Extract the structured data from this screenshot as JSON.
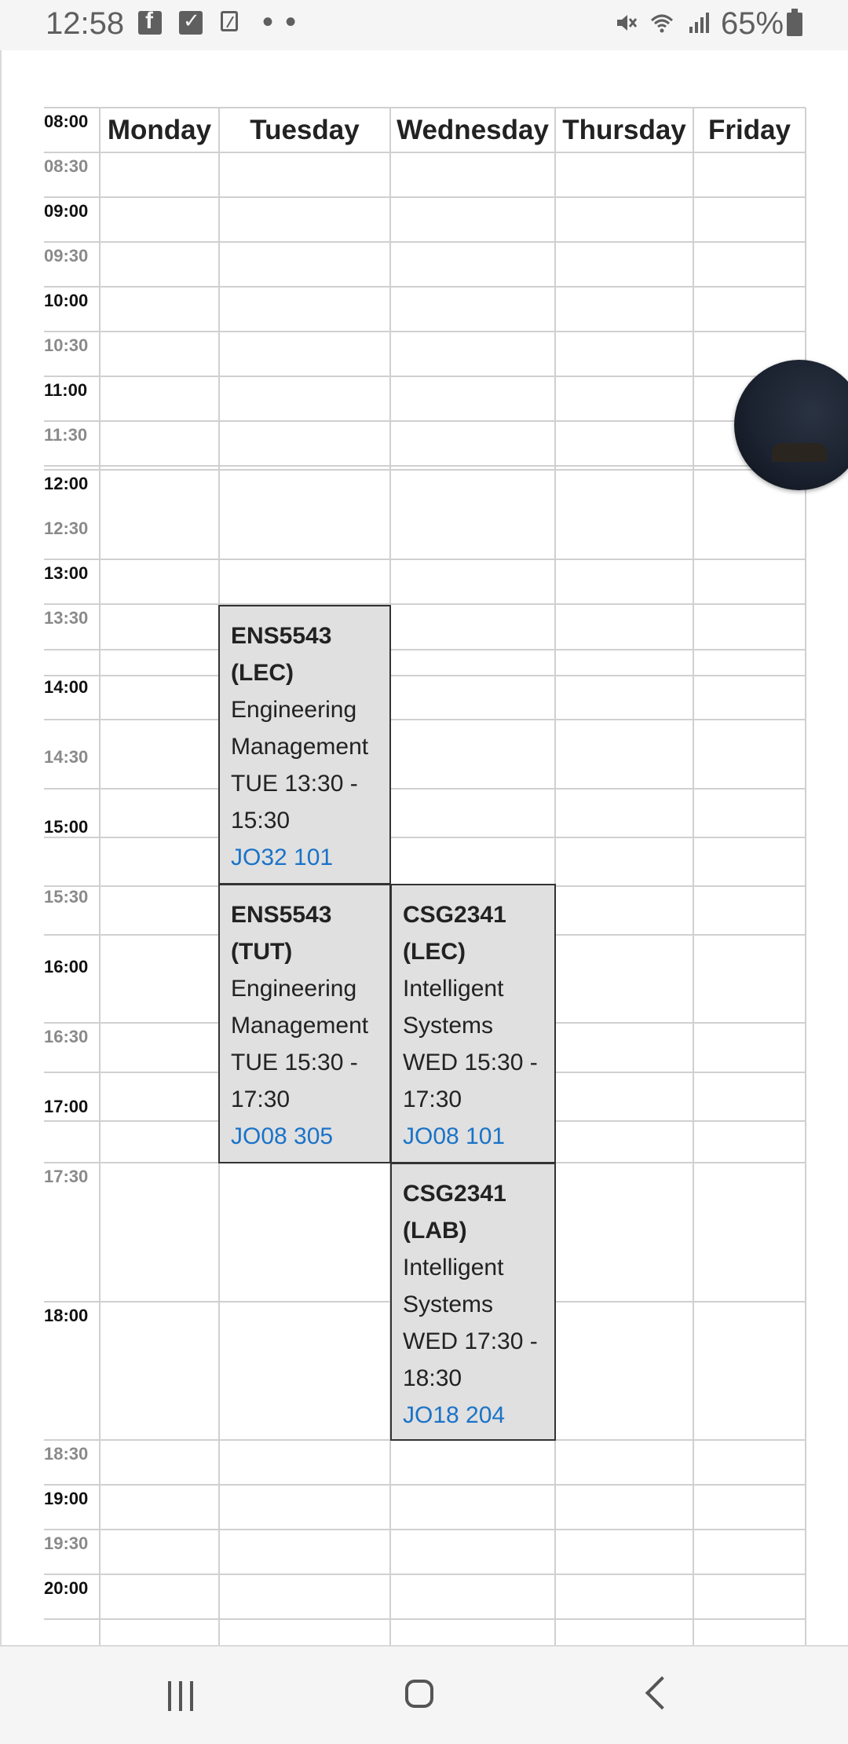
{
  "status_bar": {
    "time": "12:58",
    "more_indicator": "• •",
    "battery_percent": "65%",
    "icons": [
      "facebook-icon",
      "tasks-check-icon",
      "phone-screen-icon",
      "mute-icon",
      "wifi-icon",
      "signal-icon",
      "battery-icon"
    ]
  },
  "timetable": {
    "days": [
      "Monday",
      "Tuesday",
      "Wednesday",
      "Thursday",
      "Friday"
    ],
    "times": [
      "08:00",
      "08:30",
      "09:00",
      "09:30",
      "10:00",
      "10:30",
      "11:00",
      "11:30",
      "12:00",
      "12:30",
      "13:00",
      "13:30",
      "14:00",
      "14:30",
      "15:00",
      "15:30",
      "16:00",
      "16:30",
      "17:00",
      "17:30",
      "18:00",
      "18:30",
      "19:00",
      "19:30",
      "20:00"
    ],
    "events": [
      {
        "code": "ENS5543",
        "type": "(LEC)",
        "title": "Engineering Management",
        "time": "TUE 13:30 - 15:30",
        "room": "JO32 101",
        "day": "Tuesday",
        "start": "13:30",
        "end": "15:30"
      },
      {
        "code": "ENS5543",
        "type": "(TUT)",
        "title": "Engineering Management",
        "time": "TUE 15:30 - 17:30",
        "room": "JO08 305",
        "day": "Tuesday",
        "start": "15:30",
        "end": "17:30"
      },
      {
        "code": "CSG2341",
        "type": "(LEC)",
        "title": "Intelligent Systems",
        "time": "WED 15:30 - 17:30",
        "room": "JO08 101",
        "day": "Wednesday",
        "start": "15:30",
        "end": "17:30"
      },
      {
        "code": "CSG2341",
        "type": "(LAB)",
        "title": "Intelligent Systems",
        "time": "WED 17:30 - 18:30",
        "room": "JO18 204",
        "day": "Wednesday",
        "start": "17:30",
        "end": "18:30"
      }
    ]
  },
  "floating_bubble": {
    "icon": "chat-head-icon"
  },
  "nav_bar": {
    "icons": [
      "recent-apps-icon",
      "home-icon",
      "back-icon"
    ]
  },
  "colors": {
    "event_bg": "#e0e0e0",
    "room_link": "#1a73c8",
    "grid_line": "#d0d0d0"
  }
}
